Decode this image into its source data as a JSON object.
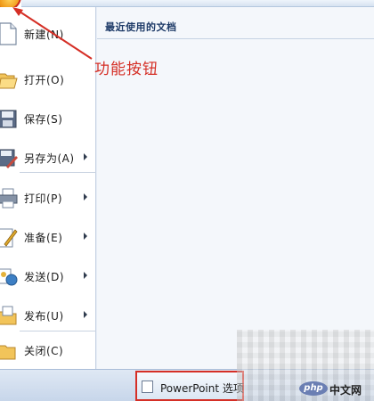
{
  "menu": {
    "items": [
      {
        "id": "new",
        "label": "新建(N)",
        "icon": "new-document-icon",
        "has_submenu": false
      },
      {
        "id": "open",
        "label": "打开(O)",
        "icon": "open-folder-icon",
        "has_submenu": false
      },
      {
        "id": "save",
        "label": "保存(S)",
        "icon": "save-disk-icon",
        "has_submenu": false
      },
      {
        "id": "saveas",
        "label": "另存为(A)",
        "icon": "save-as-icon",
        "has_submenu": true
      },
      {
        "id": "print",
        "label": "打印(P)",
        "icon": "printer-icon",
        "has_submenu": true
      },
      {
        "id": "prepare",
        "label": "准备(E)",
        "icon": "prepare-pen-icon",
        "has_submenu": true
      },
      {
        "id": "send",
        "label": "发送(D)",
        "icon": "send-icon",
        "has_submenu": true
      },
      {
        "id": "publish",
        "label": "发布(U)",
        "icon": "publish-folder-icon",
        "has_submenu": true
      },
      {
        "id": "close",
        "label": "关闭(C)",
        "icon": "close-folder-icon",
        "has_submenu": false
      }
    ]
  },
  "recent": {
    "title": "最近使用的文档"
  },
  "annotation": {
    "text": "功能按钮",
    "color": "#d52f26"
  },
  "footer": {
    "options_label": "PowerPoint 选项"
  },
  "watermark": {
    "logo": "php",
    "text": "中文网"
  },
  "colors": {
    "accent": "#d52f26",
    "header_text": "#1e3b68",
    "menu_bg": "#e8eef7"
  }
}
